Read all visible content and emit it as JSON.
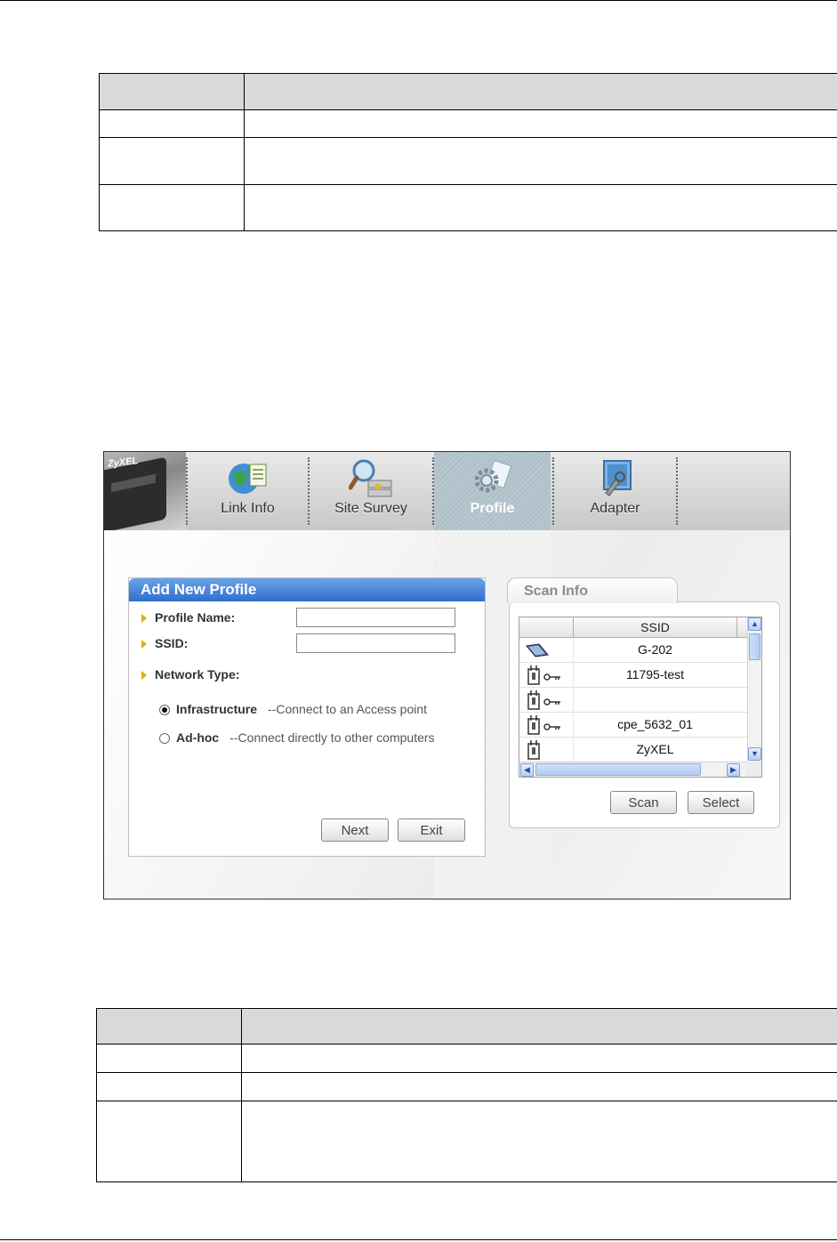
{
  "app": {
    "brand": "ZyXEL",
    "tabs": [
      {
        "label": "Link Info",
        "icon": "globe-document-icon"
      },
      {
        "label": "Site Survey",
        "icon": "magnifier-network-icon"
      },
      {
        "label": "Profile",
        "icon": "gear-document-icon",
        "active": true
      },
      {
        "label": "Adapter",
        "icon": "adapter-tools-icon"
      }
    ],
    "add_profile": {
      "title": "Add New Profile",
      "profile_name_label": "Profile Name:",
      "profile_name_value": "",
      "ssid_label": "SSID:",
      "ssid_value": "",
      "network_type_label": "Network Type:",
      "options": [
        {
          "name": "Infrastructure",
          "desc": "--Connect to an Access point",
          "selected": true
        },
        {
          "name": "Ad-hoc",
          "desc": "--Connect directly to other computers",
          "selected": false
        }
      ],
      "next_label": "Next",
      "exit_label": "Exit"
    },
    "scan_info": {
      "title": "Scan Info",
      "column": "SSID",
      "rows": [
        {
          "ssid": "G-202",
          "icon": "adhoc-card-icon"
        },
        {
          "ssid": "11795-test",
          "icon": "access-point-locked-icon"
        },
        {
          "ssid": "",
          "icon": "access-point-locked-icon"
        },
        {
          "ssid": "cpe_5632_01",
          "icon": "access-point-locked-icon"
        },
        {
          "ssid": "ZyXEL",
          "icon": "access-point-icon"
        }
      ],
      "scan_label": "Scan",
      "select_label": "Select"
    }
  },
  "colors": {
    "panel_title": "#2f6fcb",
    "arrow": "#d7b400",
    "active_tab": "#aebfc8"
  }
}
